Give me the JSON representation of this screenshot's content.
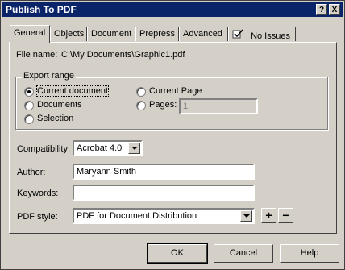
{
  "window": {
    "title": "Publish To PDF",
    "help_btn": "?",
    "close_btn": "X"
  },
  "tabs": [
    {
      "label": "General"
    },
    {
      "label": "Objects"
    },
    {
      "label": "Document"
    },
    {
      "label": "Prepress"
    },
    {
      "label": "Advanced"
    },
    {
      "label": "No Issues",
      "icon": "checkmark-icon"
    }
  ],
  "general": {
    "file_name_label": "File name:",
    "file_name_value": "C:\\My Documents\\Graphic1.pdf",
    "export_range": {
      "legend": "Export range",
      "current_document": "Current document",
      "documents": "Documents",
      "selection": "Selection",
      "current_page": "Current Page",
      "pages": "Pages:",
      "pages_value": "1",
      "selected": "current_document"
    },
    "compatibility_label": "Compatibility:",
    "compatibility_value": "Acrobat 4.0",
    "author_label": "Author:",
    "author_value": "Maryann Smith",
    "keywords_label": "Keywords:",
    "keywords_value": "",
    "pdf_style_label": "PDF style:",
    "pdf_style_value": "PDF for Document Distribution",
    "add_style": "+",
    "remove_style": "−"
  },
  "buttons": {
    "ok": "OK",
    "cancel": "Cancel",
    "help": "Help"
  }
}
